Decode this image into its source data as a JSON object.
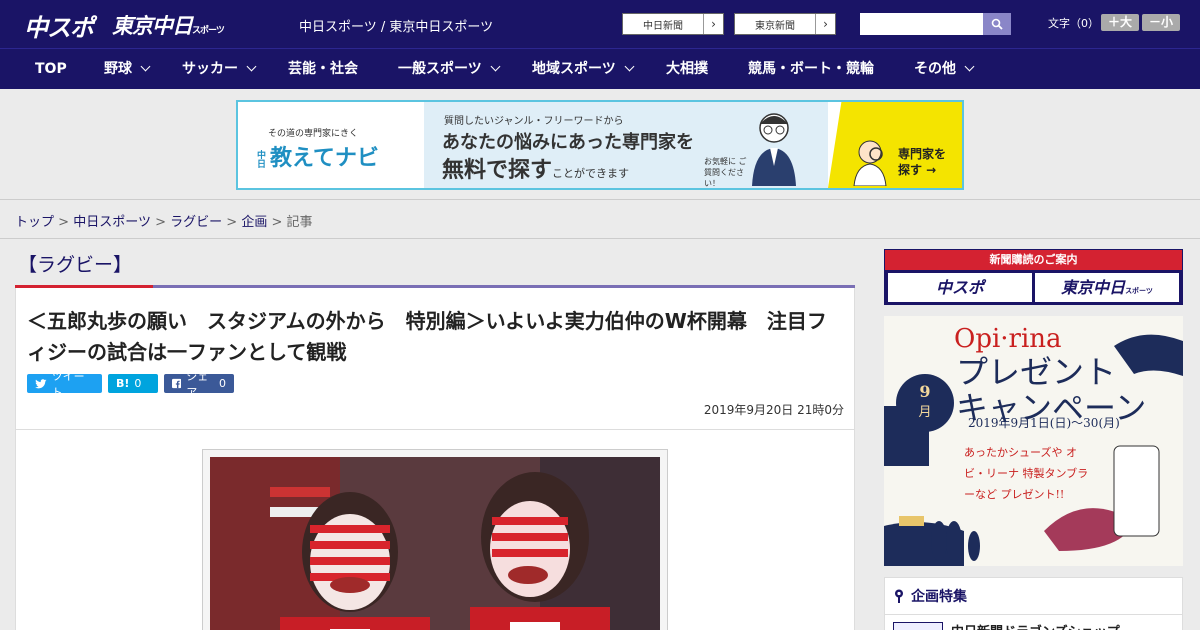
{
  "header": {
    "logo_chuspo": "中スポ",
    "logo_tokyo": "東京中日",
    "logo_tokyo_suffix": "スポーツ",
    "site_links": "中日スポーツ / 東京中日スポーツ",
    "paper_buttons": [
      "中日新聞",
      "東京新聞"
    ],
    "fontsize_label": "文字（0）",
    "fontsize_up": "＋大",
    "fontsize_down": "－小",
    "search_placeholder": ""
  },
  "nav": [
    {
      "label": "TOP",
      "dropdown": false
    },
    {
      "label": "野球",
      "dropdown": true
    },
    {
      "label": "サッカー",
      "dropdown": true
    },
    {
      "label": "芸能・社会",
      "dropdown": false
    },
    {
      "label": "一般スポーツ",
      "dropdown": true
    },
    {
      "label": "地域スポーツ",
      "dropdown": true
    },
    {
      "label": "大相撲",
      "dropdown": false
    },
    {
      "label": "競馬・ボート・競輪",
      "dropdown": false
    },
    {
      "label": "その他",
      "dropdown": true
    }
  ],
  "ad": {
    "small": "その道の専門家にきく",
    "brand": "教えてナビ",
    "brand_prefix": "中日",
    "line1": "質問したいジャンル・フリーワードから",
    "line2": "あなたの悩みにあった専門家を",
    "line3": "無料で探す",
    "line3_suffix": "ことができます",
    "note": "お気軽に ご質問ください！",
    "cta": "専門家を 探す →"
  },
  "breadcrumb": {
    "items": [
      "トップ",
      "中日スポーツ",
      "ラグビー",
      "企画"
    ],
    "current": "記事",
    "sep": ">"
  },
  "article": {
    "category": "【ラグビー】",
    "headline": "＜五郎丸歩の願い　スタジアムの外から　特別編＞いよいよ実力伯仲のW杯開幕　注目フィジーの試合は一ファンとして観戦",
    "tweet_label": "ツイート",
    "hatena_label": "B!",
    "hatena_count": "0",
    "share_label": "シェア",
    "share_count": "0",
    "date": "2019年9月20日 21時0分"
  },
  "sidebar": {
    "subscribe_head": "新聞購読のご案内",
    "sub_logo1": "中スポ",
    "sub_logo2": "東京中日",
    "sub_logo2_suffix": "スポーツ",
    "campaign_brand": "Opi·rina",
    "campaign_title": "プレゼント キャンペーン",
    "campaign_month": "9",
    "campaign_month_unit": "月",
    "campaign_dates": "2019年9月1日(日)〜30(月)",
    "campaign_blurb": "あったかシューズや オビ・リーナ 特製タンブラーなど プレゼント!!",
    "feature_title": "企画特集",
    "feature_item": "中日新聞ドラゴンズショップ"
  },
  "colors": {
    "brand_navy": "#1a1466",
    "accent_red": "#d42231",
    "twitter": "#1da1f2",
    "hatena": "#00a4de",
    "facebook": "#3b5998"
  }
}
